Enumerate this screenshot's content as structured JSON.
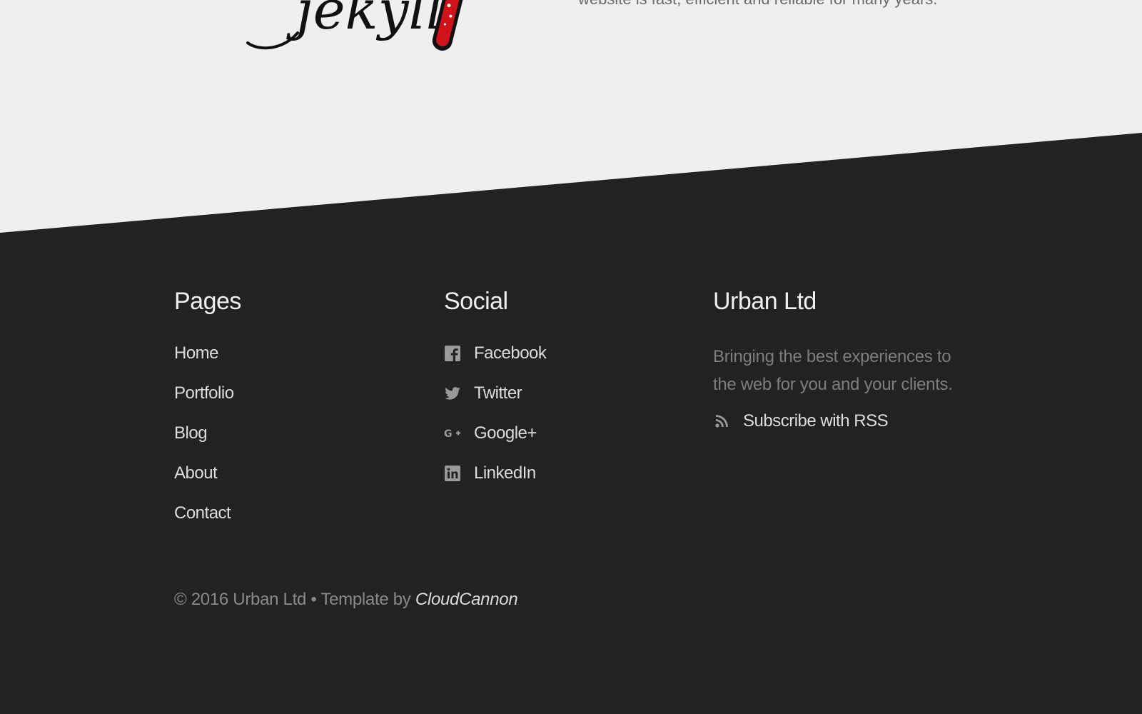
{
  "header": {
    "logo_text": "jekyll",
    "intro_text": "website is fast, efficient and reliable for many years."
  },
  "footer": {
    "pages": {
      "heading": "Pages",
      "items": [
        "Home",
        "Portfolio",
        "Blog",
        "About",
        "Contact"
      ]
    },
    "social": {
      "heading": "Social",
      "items": [
        {
          "label": "Facebook",
          "icon": "facebook-icon"
        },
        {
          "label": "Twitter",
          "icon": "twitter-icon"
        },
        {
          "label": "Google+",
          "icon": "google-plus-icon"
        },
        {
          "label": "LinkedIn",
          "icon": "linkedin-icon"
        }
      ]
    },
    "company": {
      "heading": "Urban Ltd",
      "description": "Bringing the best experiences to the web for you and your clients.",
      "rss_label": "Subscribe with RSS",
      "rss_icon": "rss-icon"
    },
    "copyright": {
      "text": "© 2016 Urban Ltd • Template by ",
      "link_label": "CloudCannon"
    }
  },
  "colors": {
    "background_light": "#efefef",
    "footer_dark": "#222222",
    "logo_red": "#d0121b",
    "text_light": "#dcdcdc",
    "text_muted": "#7d7d7d",
    "icon_gray": "#9a9a9a"
  }
}
